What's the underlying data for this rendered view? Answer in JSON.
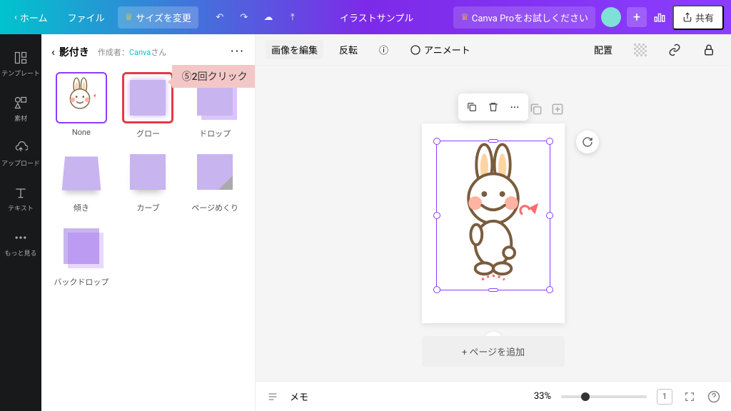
{
  "header": {
    "home": "ホーム",
    "file": "ファイル",
    "resize": "サイズを変更",
    "title": "イラストサンプル",
    "try_pro": "Canva Proをお試しください",
    "share": "共有"
  },
  "rail": {
    "templates": "テンプレート",
    "elements": "素材",
    "uploads": "アップロード",
    "text": "テキスト",
    "more": "もっと見る"
  },
  "sidebar": {
    "title": "影付き",
    "author_prefix": "作成者：",
    "author_name": "Canva",
    "author_suffix": "さん",
    "items": [
      {
        "label": "None"
      },
      {
        "label": "グロー"
      },
      {
        "label": "ドロップ"
      },
      {
        "label": "傾き"
      },
      {
        "label": "カーブ"
      },
      {
        "label": "ページめくり"
      },
      {
        "label": "バックドロップ"
      }
    ]
  },
  "annotation": "⑤2回クリック",
  "toolbar": {
    "edit_image": "画像を編集",
    "flip": "反転",
    "animate": "アニメート",
    "position": "配置"
  },
  "canvas": {
    "add_page": "+ ページを追加"
  },
  "footer": {
    "notes": "メモ",
    "zoom": "33%",
    "page": "1"
  }
}
